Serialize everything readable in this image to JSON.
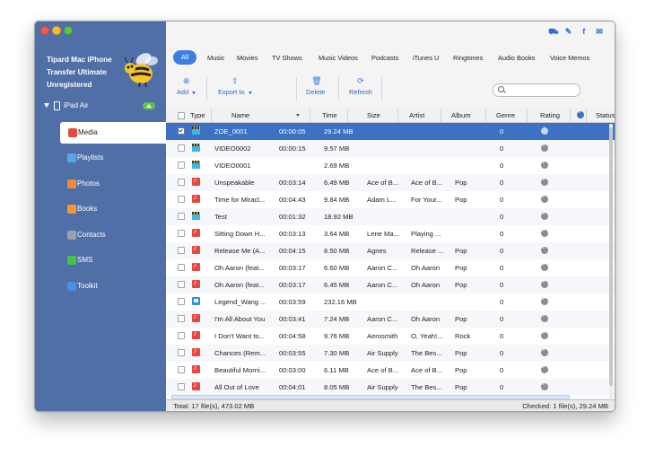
{
  "app": {
    "brand": "Tipard Mac iPhone Transfer Ultimate",
    "registration": "Unregistered"
  },
  "sidebar": {
    "device": "iPad Air",
    "items": [
      {
        "label": "Media",
        "icon": "media-icon",
        "color": "#e04a3f"
      },
      {
        "label": "Playlists",
        "icon": "playlist-icon",
        "color": "#5aa6e3"
      },
      {
        "label": "Photos",
        "icon": "photos-icon",
        "color": "#f08a37"
      },
      {
        "label": "Books",
        "icon": "books-icon",
        "color": "#f29a33"
      },
      {
        "label": "Contacts",
        "icon": "contacts-icon",
        "color": "#9aa3ad"
      },
      {
        "label": "SMS",
        "icon": "sms-icon",
        "color": "#48c24a"
      },
      {
        "label": "Toolkit",
        "icon": "toolkit-icon",
        "color": "#4b8fde"
      }
    ]
  },
  "categories": [
    "All",
    "Music",
    "Movies",
    "TV Shows",
    "Music Videos",
    "Podcasts",
    "iTunes U",
    "Ringtones",
    "Audio Books",
    "Voice Memos"
  ],
  "toolbar": {
    "add": "Add",
    "export": "Export to",
    "delete": "Delete",
    "refresh": "Refresh"
  },
  "search": {
    "placeholder": ""
  },
  "table": {
    "columns": [
      "Type",
      "Name",
      "Time",
      "Size",
      "Artist",
      "Album",
      "Genre",
      "Rating",
      "Status"
    ],
    "rows": [
      {
        "type": "movie",
        "name": "ZOE_0001",
        "time": "00:00:05",
        "size": "29.24 MB",
        "artist": "",
        "album": "",
        "genre": "",
        "rating": "0",
        "checked": true,
        "selected": true
      },
      {
        "type": "movie",
        "name": "VIDEO0002",
        "time": "00:00:15",
        "size": "9.57 MB",
        "artist": "",
        "album": "",
        "genre": "",
        "rating": "0",
        "checked": false,
        "selected": false
      },
      {
        "type": "movie",
        "name": "VIDEO0001",
        "time": "",
        "size": "2.69 MB",
        "artist": "",
        "album": "",
        "genre": "",
        "rating": "0",
        "checked": false,
        "selected": false
      },
      {
        "type": "music",
        "name": "Unspeakable",
        "time": "00:03:14",
        "size": "6.49 MB",
        "artist": "Ace of B...",
        "album": "Ace of B...",
        "genre": "Pop",
        "rating": "0",
        "checked": false,
        "selected": false
      },
      {
        "type": "music",
        "name": "Time for Miracl...",
        "time": "00:04:43",
        "size": "9.84 MB",
        "artist": "Adam L...",
        "album": "For Your...",
        "genre": "Pop",
        "rating": "0",
        "checked": false,
        "selected": false
      },
      {
        "type": "movie",
        "name": "Test",
        "time": "00:01:32",
        "size": "18.92 MB",
        "artist": "",
        "album": "",
        "genre": "",
        "rating": "0",
        "checked": false,
        "selected": false
      },
      {
        "type": "music",
        "name": "Sitting Down H...",
        "time": "00:03:13",
        "size": "3.64 MB",
        "artist": "Lene Ma...",
        "album": "Playing ...",
        "genre": "",
        "rating": "0",
        "checked": false,
        "selected": false
      },
      {
        "type": "music",
        "name": "Release Me (A...",
        "time": "00:04:15",
        "size": "8.50 MB",
        "artist": "Agnes",
        "album": "Release ...",
        "genre": "Pop",
        "rating": "0",
        "checked": false,
        "selected": false
      },
      {
        "type": "music",
        "name": "Oh Aaron (feat...",
        "time": "00:03:17",
        "size": "6.60 MB",
        "artist": "Aaron C...",
        "album": "Oh Aaron",
        "genre": "Pop",
        "rating": "0",
        "checked": false,
        "selected": false
      },
      {
        "type": "music",
        "name": "Oh Aaron (feat...",
        "time": "00:03:17",
        "size": "6.45 MB",
        "artist": "Aaron C...",
        "album": "Oh Aaron",
        "genre": "Pop",
        "rating": "0",
        "checked": false,
        "selected": false
      },
      {
        "type": "tv",
        "name": "Legend_Wang ...",
        "time": "00:03:59",
        "size": "232.16 MB",
        "artist": "",
        "album": "",
        "genre": "",
        "rating": "0",
        "checked": false,
        "selected": false
      },
      {
        "type": "music",
        "name": "I'm All About You",
        "time": "00:03:41",
        "size": "7.24 MB",
        "artist": "Aaron C...",
        "album": "Oh Aaron",
        "genre": "Pop",
        "rating": "0",
        "checked": false,
        "selected": false
      },
      {
        "type": "music",
        "name": "I Don't Want to...",
        "time": "00:04:58",
        "size": "9.76 MB",
        "artist": "Aerosmith",
        "album": "O, Yeah!...",
        "genre": "Rock",
        "rating": "0",
        "checked": false,
        "selected": false
      },
      {
        "type": "music",
        "name": "Chances (Rem...",
        "time": "00:03:55",
        "size": "7.30 MB",
        "artist": "Air Supply",
        "album": "The Bes...",
        "genre": "Pop",
        "rating": "0",
        "checked": false,
        "selected": false
      },
      {
        "type": "music",
        "name": "Beautiful Morni...",
        "time": "00:03:00",
        "size": "6.11 MB",
        "artist": "Ace of B...",
        "album": "Ace of B...",
        "genre": "Pop",
        "rating": "0",
        "checked": false,
        "selected": false
      },
      {
        "type": "music",
        "name": "All Out of Love",
        "time": "00:04:01",
        "size": "8.05 MB",
        "artist": "Air Supply",
        "album": "The Bes...",
        "genre": "Pop",
        "rating": "0",
        "checked": false,
        "selected": false
      }
    ]
  },
  "status": {
    "total": "Total: 17 file(s), 473.02 MB",
    "checked": "Checked: 1 file(s), 29.24 MB"
  },
  "colors": {
    "accent": "#3d7fe0",
    "sidebar": "#4f6fa6",
    "selection": "#3d71c4"
  }
}
